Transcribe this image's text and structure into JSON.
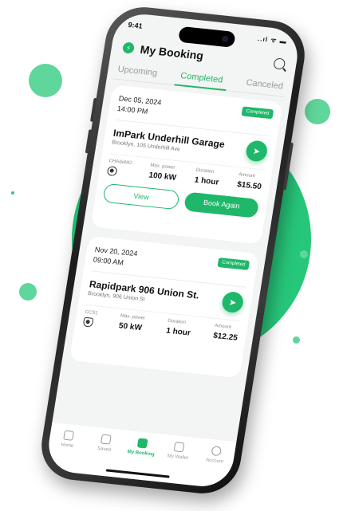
{
  "status": {
    "time": "9:41",
    "signal": "..ıl ᯤ ▬"
  },
  "header": {
    "title": "My Booking",
    "logo": "bolt-icon",
    "search_icon": "search-icon"
  },
  "tabs": [
    {
      "label": "Upcoming",
      "active": false
    },
    {
      "label": "Completed",
      "active": true
    },
    {
      "label": "Canceled",
      "active": false
    }
  ],
  "bookings": [
    {
      "date": "Dec 05, 2024",
      "time": "14:00 PM",
      "status": "Completed",
      "name": "ImPark Underhill Garage",
      "address": "Brooklyn, 105 Underhill Ave",
      "connector_label": "CHAdeMO",
      "connector_icon": "chademo-plug-icon",
      "power_label": "Max. power",
      "power": "100 kW",
      "duration_label": "Duration",
      "duration": "1 hour",
      "amount_label": "Amount",
      "amount": "$15.50",
      "view_label": "View",
      "again_label": "Book Again"
    },
    {
      "date": "Nov 20, 2024",
      "time": "09:00 AM",
      "status": "Completed",
      "name": "Rapidpark 906 Union St.",
      "address": "Brooklyn, 906 Union St",
      "connector_label": "CCS1",
      "connector_icon": "ccs1-plug-icon",
      "power_label": "Max. power",
      "power": "50 kW",
      "duration_label": "Duration",
      "duration": "1 hour",
      "amount_label": "Amount",
      "amount": "$12.25"
    }
  ],
  "nav": [
    {
      "label": "Home",
      "icon": "home-icon",
      "active": false
    },
    {
      "label": "Saved",
      "icon": "bookmark-icon",
      "active": false
    },
    {
      "label": "My Booking",
      "icon": "booking-icon",
      "active": true
    },
    {
      "label": "My Wallet",
      "icon": "wallet-icon",
      "active": false
    },
    {
      "label": "Account",
      "icon": "account-icon",
      "active": false
    }
  ],
  "colors": {
    "accent": "#1fb86a",
    "background_disc": "#27c77a"
  }
}
